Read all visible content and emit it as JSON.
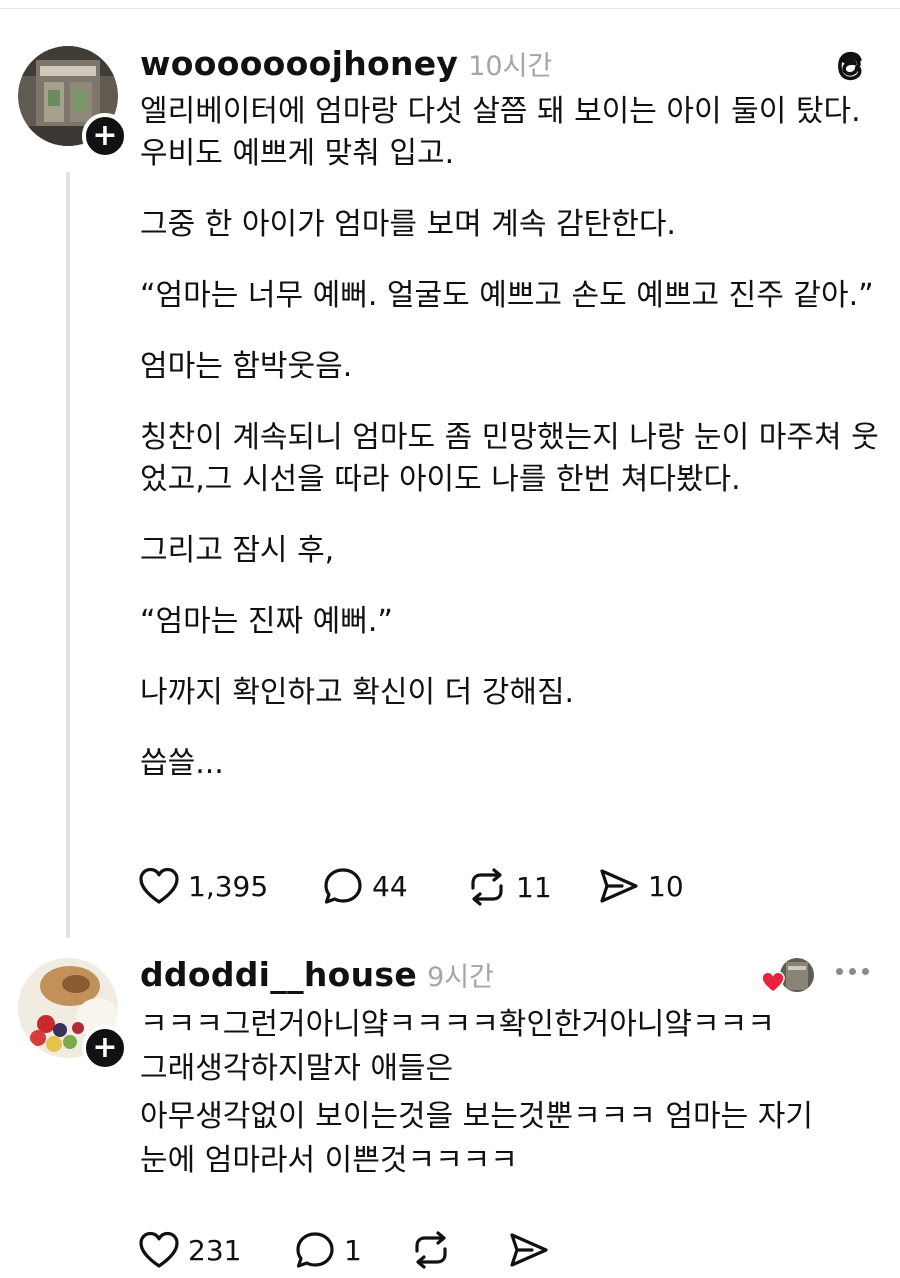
{
  "post": {
    "username": "wooooooojhoney",
    "time": "10시간",
    "avatar_icon": "avatar-photo",
    "paragraphs": [
      "엘리베이터에 엄마랑 다섯 살쯤 돼 보이는 아이 둘이 탔다. 우비도 예쁘게 맞춰 입고.",
      "그중 한 아이가 엄마를 보며 계속 감탄한다.",
      "“엄마는 너무 예뻐. 얼굴도 예쁘고 손도 예쁘고 진주 같아.”",
      "엄마는 함박웃음.",
      "칭찬이 계속되니 엄마도 좀 민망했는지 나랑 눈이 마주쳐 웃었고,그 시선을 따라 아이도 나를 한번 쳐다봤다.",
      "그리고 잠시 후,",
      "“엄마는 진짜 예뻐.”",
      "나까지 확인하고 확신이 더 강해짐.",
      "씁쓸..."
    ],
    "likes": "1,395",
    "comments": "44",
    "reposts": "11",
    "shares": "10"
  },
  "reply": {
    "username": "ddoddi__house",
    "time": "9시간",
    "lines": [
      "ㅋㅋㅋ그런거아니얔ㅋㅋㅋㅋ확인한거아니얔ㅋㅋㅋ",
      "그래생각하지말자 애들은",
      "아무생각없이 보이는것을 보는것뿐ㅋㅋㅋ 엄마는 자기",
      "눈에 엄마라서 이쁜것ㅋㅋㅋㅋ"
    ],
    "likes": "231",
    "comments": "1"
  },
  "colors": {
    "accent_heart": "#e8243c",
    "muted": "#a5a5a5",
    "text": "#111111"
  },
  "icons": [
    "threads-logo-icon",
    "plus-icon",
    "heart-icon",
    "comment-icon",
    "repost-icon",
    "share-icon",
    "more-icon"
  ]
}
